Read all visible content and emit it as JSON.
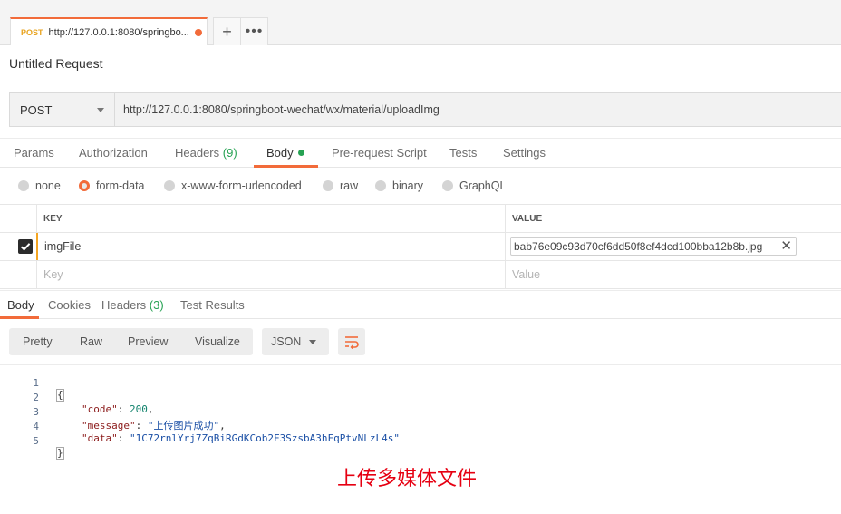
{
  "request_tab": {
    "method": "POST",
    "url": "http://127.0.0.1:8080/springbo..."
  },
  "tab_actions": {
    "add": "+",
    "more": "•••"
  },
  "request_title": "Untitled Request",
  "url_bar": {
    "method": "POST",
    "url": "http://127.0.0.1:8080/springboot-wechat/wx/material/uploadImg"
  },
  "request_tabs": [
    {
      "label": "Params"
    },
    {
      "label": "Authorization"
    },
    {
      "label": "Headers",
      "count": "(9)"
    },
    {
      "label": "Body"
    },
    {
      "label": "Pre-request Script"
    },
    {
      "label": "Tests"
    },
    {
      "label": "Settings"
    }
  ],
  "body_types": [
    "none",
    "form-data",
    "x-www-form-urlencoded",
    "raw",
    "binary",
    "GraphQL"
  ],
  "body_type_selected": "form-data",
  "kv_table": {
    "headers": {
      "key": "KEY",
      "value": "VALUE"
    },
    "rows": [
      {
        "checked": true,
        "key": "imgFile",
        "value": "bab76e09c93d70cf6dd50f8ef4dcd100bba12b8b.jpg"
      }
    ],
    "placeholder": {
      "key": "Key",
      "value": "Value"
    }
  },
  "response_tabs": [
    {
      "label": "Body"
    },
    {
      "label": "Cookies"
    },
    {
      "label": "Headers",
      "count": "(3)"
    },
    {
      "label": "Test Results"
    }
  ],
  "response_views": [
    "Pretty",
    "Raw",
    "Preview",
    "Visualize"
  ],
  "response_format": "JSON",
  "response_body": {
    "line_numbers": [
      "1",
      "2",
      "3",
      "4",
      "5"
    ],
    "open_brace": "{",
    "close_brace": "}",
    "fields": [
      {
        "key": "\"code\"",
        "value": "200",
        "value_type": "number"
      },
      {
        "key": "\"message\"",
        "value": "\"上传图片成功\"",
        "value_type": "string"
      },
      {
        "key": "\"data\"",
        "value": "\"1C72rnlYrj7ZqBiRGdKCob2F3SzsbA3hFqPtvNLzL4s\"",
        "value_type": "string"
      }
    ]
  },
  "caption": "上传多媒体文件",
  "colors": {
    "accent": "#f26b3a",
    "count_green": "#26a253",
    "caption_red": "#e60012"
  }
}
